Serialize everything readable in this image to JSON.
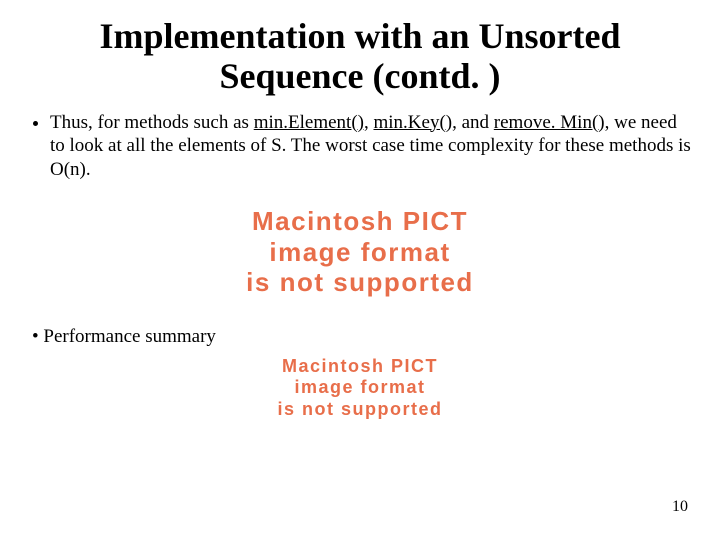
{
  "slide": {
    "title": "Implementation with an Unsorted Sequence (contd. )",
    "bullet_pre": "Thus, for methods such as ",
    "method1": "min.Element()",
    "sep1": ", ",
    "method2": "min.Key()",
    "sep2": ", and ",
    "method3": "remove. Min()",
    "bullet_post": ", we need to look at all the elements of S. The worst case time complexity for these methods is O(n).",
    "pict_large": "Macintosh PICT\nimage format\nis not supported",
    "perf_bullet_marker": "• ",
    "perf_summary": "Performance summary",
    "pict_small": "Macintosh PICT\nimage format\nis not supported",
    "page_number": "10"
  }
}
